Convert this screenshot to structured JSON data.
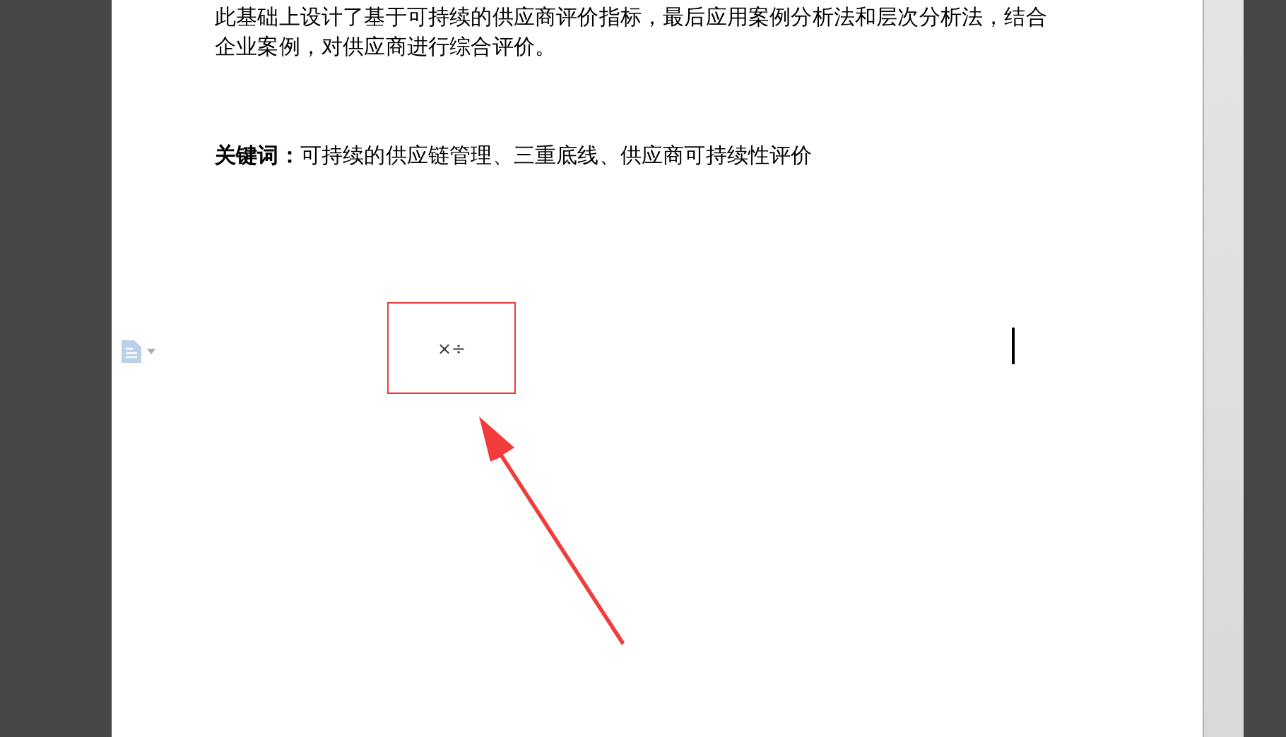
{
  "document": {
    "body_lines": [
      "此基础上设计了基于可持续的供应商评价指标，最后应用案例分析法和层次分析法，结合",
      "企业案例，对供应商进行综合评价。"
    ],
    "keywords": {
      "label": "关键词：",
      "text": "可持续的供应链管理、三重底线、供应商可持续性评价"
    },
    "highlighted_box": {
      "text": "×÷"
    }
  }
}
